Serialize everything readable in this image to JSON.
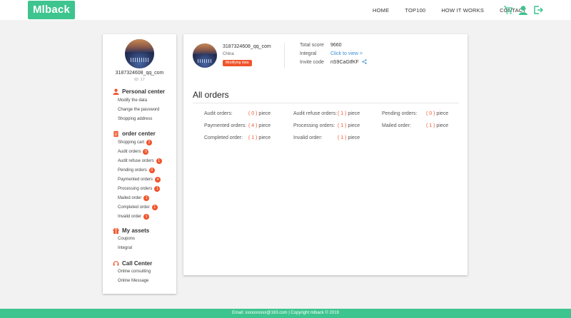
{
  "header": {
    "logo": "Mlback",
    "nav": [
      "HOME",
      "TOP100",
      "HOW IT WORKS",
      "CONTACT"
    ],
    "icons": [
      "cart-icon",
      "user-icon",
      "logout-icon"
    ],
    "accent_color": "#3ec48e"
  },
  "sidebar": {
    "username": "3187324608_qq_com",
    "id_text": "ID:  17",
    "sections": [
      {
        "title": "Personal center",
        "icon": "person-icon",
        "links": [
          {
            "label": "Modify the data"
          },
          {
            "label": "Change the password"
          },
          {
            "label": "Shopping address"
          }
        ]
      },
      {
        "title": "order center",
        "icon": "clipboard-icon",
        "links": [
          {
            "label": "Shopping cart",
            "badge": "2"
          },
          {
            "label": "Audit orders",
            "badge": "0"
          },
          {
            "label": "Audit refuse orders",
            "badge": "1"
          },
          {
            "label": "Pending orders",
            "badge": "0"
          },
          {
            "label": "Paymented orders",
            "badge": "4"
          },
          {
            "label": "Processing orders",
            "badge": "1"
          },
          {
            "label": "Mailed order",
            "badge": "1"
          },
          {
            "label": "Completed order",
            "badge": "1"
          },
          {
            "label": "Invalid order",
            "badge": "1"
          }
        ]
      },
      {
        "title": "My assets",
        "icon": "gift-icon",
        "links": [
          {
            "label": "Coupons"
          },
          {
            "label": "Integral"
          }
        ]
      },
      {
        "title": "Call Center",
        "icon": "headset-icon",
        "links": [
          {
            "label": "Online consulting"
          },
          {
            "label": "Online Message"
          }
        ]
      }
    ]
  },
  "profile": {
    "username": "3187324608_qq_com",
    "country": "China",
    "modify_button": "Modifying data",
    "total_score_label": "Total score",
    "total_score": "9660",
    "integral_label": "Integral",
    "integral_link": "Click to view >",
    "invite_code_label": "Invite code",
    "invite_code": "nS9CaGtfKF"
  },
  "orders": {
    "title": "All orders",
    "unit": "piece",
    "items": [
      {
        "label": "Audit orders:",
        "count": "0"
      },
      {
        "label": "Audit refuse orders:",
        "count": "1"
      },
      {
        "label": "Pending orders:",
        "count": "0"
      },
      {
        "label": "Paymented orders:",
        "count": "4"
      },
      {
        "label": "Processing orders:",
        "count": "1"
      },
      {
        "label": "Mailed order:",
        "count": "1"
      },
      {
        "label": "Completed order:",
        "count": "1"
      },
      {
        "label": "Invalid order:",
        "count": "1"
      }
    ]
  },
  "footer": {
    "text": "Email: xxxxxxxxxx@163.com | Copyright mlback © 2019"
  },
  "colors": {
    "badge": "#f0542b",
    "link": "#3a8fd8"
  }
}
